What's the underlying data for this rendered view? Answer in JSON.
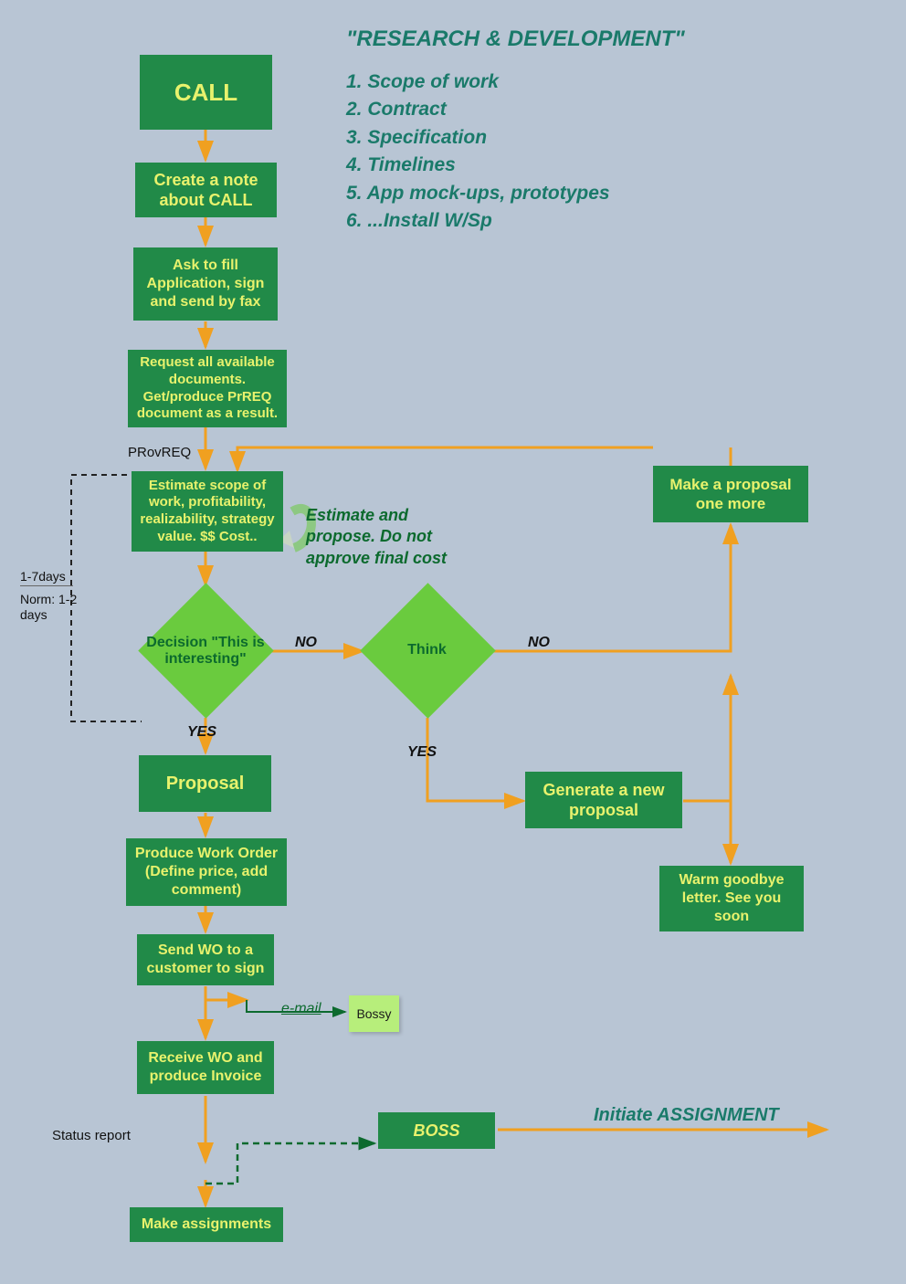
{
  "title": "\"RESEARCH & DEVELOPMENT\"",
  "list": {
    "i1": "1. Scope of work",
    "i2": "2. Contract",
    "i3": "3. Specification",
    "i4": "4. Timelines",
    "i5": "5. App mock-ups, prototypes",
    "i6": "6. ...Install W/Sp"
  },
  "nodes": {
    "call": "CALL",
    "createNote": "Create a note about CALL",
    "askFill": "Ask to fill Application, sign and send by fax",
    "requestDocs": "Request all available documents. Get/produce PrREQ document as a result.",
    "estimate": "Estimate scope of work, profitability, realizability, strategy value. $$ Cost..",
    "decision": "Decision \"This is interesting\"",
    "think": "Think",
    "proposal": "Proposal",
    "produceWO": "Produce Work Order (Define price, add comment)",
    "sendWO": "Send WO to a customer to sign",
    "receiveWO": "Receive WO and produce Invoice",
    "makeAssign": "Make assignments",
    "makeProposalMore": "Make a proposal one more",
    "genNewProposal": "Generate a new proposal",
    "warmGoodbye": "Warm goodbye letter. See you soon",
    "boss": "BOSS",
    "bossy": "Bossy"
  },
  "labels": {
    "provreq": "PRovREQ",
    "annotEstimate": "Estimate and propose. Do not approve final cost",
    "no1": "NO",
    "no2": "NO",
    "yes1": "YES",
    "yes2": "YES",
    "email": "e-mail",
    "statusReport": "Status report",
    "initiate": "Initiate ASSIGNMENT",
    "rangeTop": "1-7days",
    "rangeBot": "Norm: 1-2 days"
  },
  "colors": {
    "bg": "#b8c5d4",
    "box": "#218a48",
    "boxText": "#e8f26d",
    "diamond": "#6acb3e",
    "arrow": "#f0a020",
    "teal": "#1a7a6a",
    "darkGreen": "#0c6a2e"
  }
}
